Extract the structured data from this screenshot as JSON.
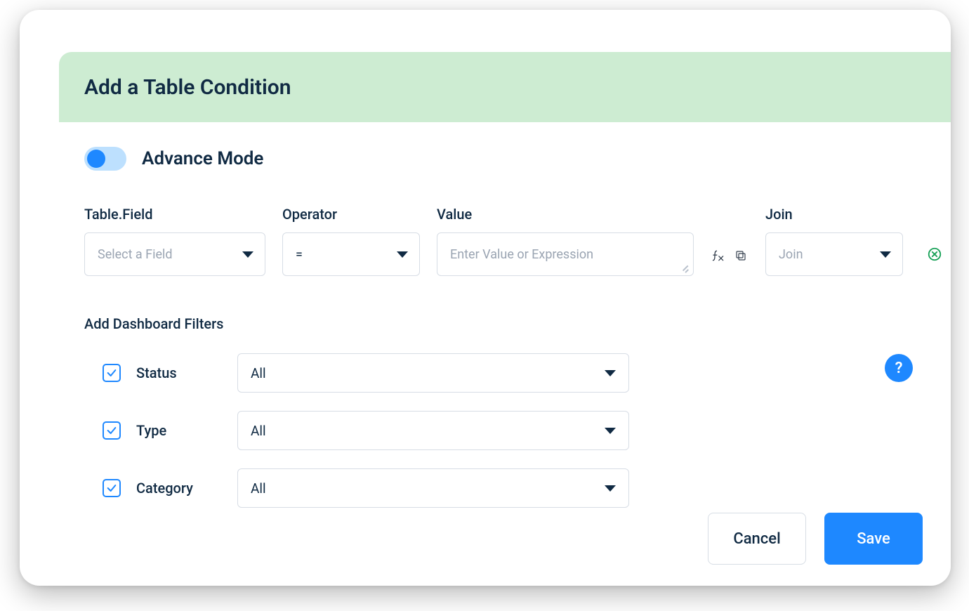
{
  "header": {
    "title": "Add a Table Condition"
  },
  "advance": {
    "label": "Advance Mode",
    "enabled": true
  },
  "condition": {
    "field": {
      "label": "Table.Field",
      "placeholder": "Select a Field"
    },
    "operator": {
      "label": "Operator",
      "value": "="
    },
    "value": {
      "label": "Value",
      "placeholder": "Enter Value or Expression"
    },
    "join": {
      "label": "Join",
      "placeholder": "Join"
    }
  },
  "filters": {
    "title": "Add Dashboard Filters",
    "items": [
      {
        "label": "Status",
        "value": "All",
        "checked": true
      },
      {
        "label": "Type",
        "value": "All",
        "checked": true
      },
      {
        "label": "Category",
        "value": "All",
        "checked": true
      }
    ]
  },
  "help": {
    "label": "?"
  },
  "footer": {
    "cancel": "Cancel",
    "save": "Save"
  }
}
